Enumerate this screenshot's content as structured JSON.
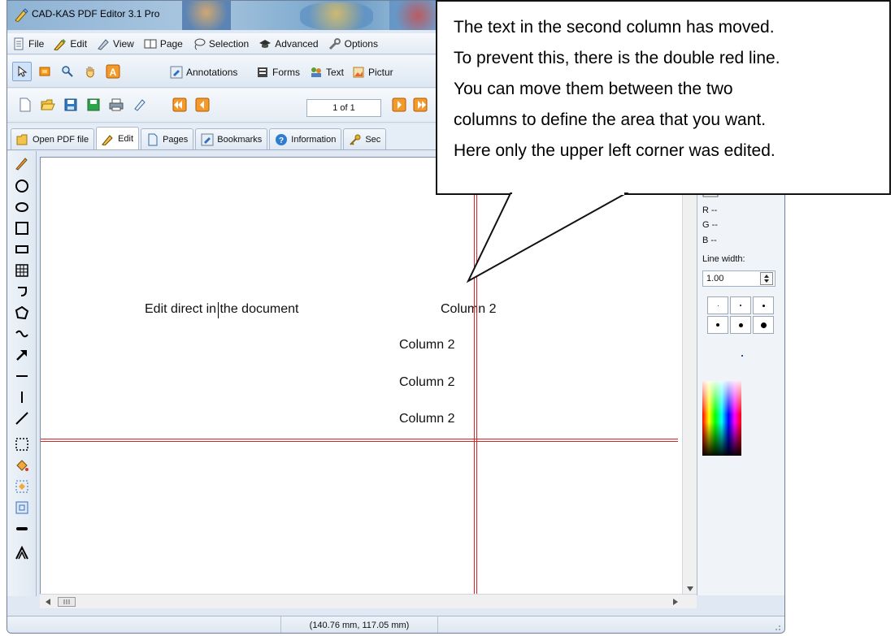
{
  "window": {
    "title": "CAD-KAS PDF Editor 3.1 Pro"
  },
  "menu": [
    {
      "label": "File",
      "icon": "file-icon"
    },
    {
      "label": "Edit",
      "icon": "edit-pen-icon"
    },
    {
      "label": "View",
      "icon": "view-icon"
    },
    {
      "label": "Page",
      "icon": "page-book-icon"
    },
    {
      "label": "Selection",
      "icon": "lasso-icon"
    },
    {
      "label": "Advanced",
      "icon": "advanced-hat-icon"
    },
    {
      "label": "Options",
      "icon": "options-wrench-icon"
    }
  ],
  "toolbar1": {
    "annotations": "Annotations",
    "forms": "Forms",
    "text": "Text",
    "pictures": "Pictur"
  },
  "toolbar2": {
    "page_indicator": "1 of 1"
  },
  "tabs": [
    {
      "label": "Open PDF file",
      "icon": "folder-open-icon"
    },
    {
      "label": "Edit",
      "icon": "edit-pen-icon",
      "active": true
    },
    {
      "label": "Pages",
      "icon": "pages-icon"
    },
    {
      "label": "Bookmarks",
      "icon": "bookmark-icon"
    },
    {
      "label": "Information",
      "icon": "info-icon"
    },
    {
      "label": "Sec",
      "icon": "key-icon"
    }
  ],
  "document": {
    "edit_text": "Edit direct in the document",
    "column_texts": [
      "Column 2",
      "Column 2",
      "Column 2",
      "Column 2"
    ]
  },
  "right_panel": {
    "r": "R --",
    "g": "G --",
    "b": "B --",
    "line_width_label": "Line width:",
    "line_width_value": "1.00"
  },
  "status": {
    "coordinates": "(140.76 mm, 117.05 mm)"
  },
  "callout": {
    "lines": [
      "The text in the second column has moved.",
      "To prevent this, there is the double red line.",
      "You can move them between the two",
      "columns to define the area that you want.",
      "Here only the upper left corner was edited."
    ]
  },
  "colors": {
    "red_line": "#d62828",
    "accent": "#7fa6d2"
  }
}
